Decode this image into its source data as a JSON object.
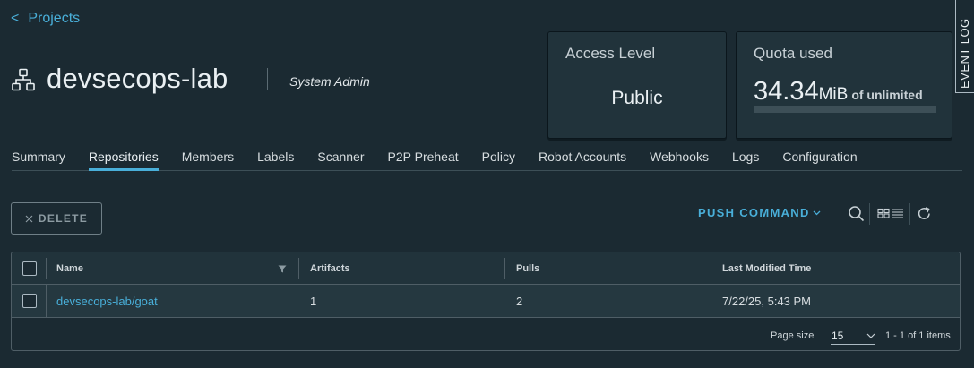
{
  "nav": {
    "back_label": "Projects",
    "back_chevron": "<"
  },
  "project": {
    "name": "devsecops-lab",
    "role": "System Admin",
    "icon": "project-hierarchy-icon"
  },
  "access_card": {
    "title": "Access Level",
    "value": "Public"
  },
  "quota_card": {
    "title": "Quota used",
    "amount": "34.34",
    "unit": "MiB",
    "of_text": "of unlimited",
    "usage_fraction": 0
  },
  "event_log": {
    "label": "EVENT LOG"
  },
  "tabs": [
    {
      "label": "Summary",
      "active": false
    },
    {
      "label": "Repositories",
      "active": true
    },
    {
      "label": "Members",
      "active": false
    },
    {
      "label": "Labels",
      "active": false
    },
    {
      "label": "Scanner",
      "active": false
    },
    {
      "label": "P2P Preheat",
      "active": false
    },
    {
      "label": "Policy",
      "active": false
    },
    {
      "label": "Robot Accounts",
      "active": false
    },
    {
      "label": "Webhooks",
      "active": false
    },
    {
      "label": "Logs",
      "active": false
    },
    {
      "label": "Configuration",
      "active": false
    }
  ],
  "toolbar": {
    "delete_label": "DELETE",
    "push_command_label": "PUSH COMMAND",
    "icons": [
      "search-icon",
      "card-list-view-toggle-icon",
      "refresh-icon"
    ]
  },
  "table": {
    "columns": [
      "Name",
      "Artifacts",
      "Pulls",
      "Last Modified Time"
    ],
    "rows": [
      {
        "name": "devsecops-lab/goat",
        "artifacts": "1",
        "pulls": "2",
        "modified": "7/22/25, 5:43 PM"
      }
    ],
    "footer": {
      "page_size_label": "Page size",
      "page_size_value": "15",
      "range_text": "1 - 1 of 1 items"
    }
  },
  "colors": {
    "background": "#1b2a32",
    "accent": "#49afd9",
    "card": "#21333b"
  }
}
